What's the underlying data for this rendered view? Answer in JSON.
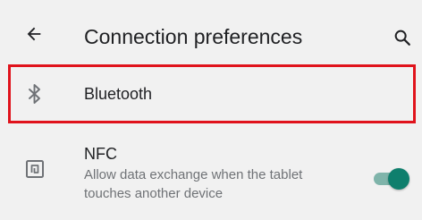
{
  "app_bar": {
    "title": "Connection preferences",
    "back_icon": "arrow-back-icon",
    "search_icon": "search-icon"
  },
  "items": [
    {
      "label": "Bluetooth",
      "icon": "bluetooth-icon"
    },
    {
      "label": "NFC",
      "summary": "Allow data exchange when the tablet touches another device",
      "icon": "nfc-icon",
      "toggle_on": true
    }
  ],
  "colors": {
    "background": "#f1f1f1",
    "highlight_border": "#e0131c",
    "toggle_thumb": "#0f7f6d",
    "toggle_track": "#7fb4aa"
  }
}
